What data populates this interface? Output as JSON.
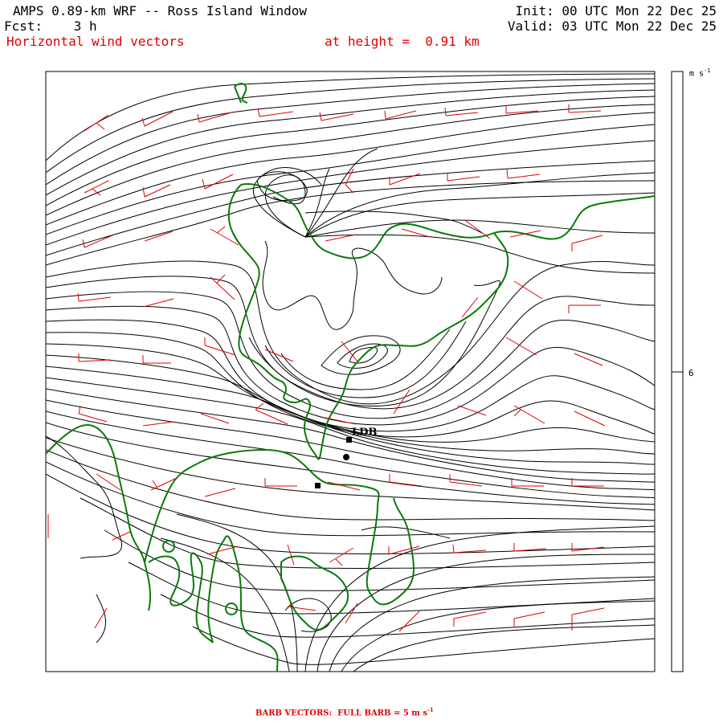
{
  "header": {
    "title": "AMPS 0.89-km WRF -- Ross Island Window",
    "init": "Init: 00 UTC Mon 22 Dec 25",
    "fcst": "Fcst:    3 h",
    "valid": "Valid: 03 UTC Mon 22 Dec 25",
    "field": "Horizontal wind vectors",
    "height": "at height =  0.91 km"
  },
  "scale": {
    "unit": "m s",
    "unit_exp": "-1",
    "tick_value": "6"
  },
  "station": {
    "label": "LDB"
  },
  "legend": {
    "text": "BARB VECTORS:  FULL BARB = 5 m s",
    "exp": "-1"
  },
  "colors": {
    "streamline": "#000000",
    "coastline": "#0a7a0a",
    "barb": "#e00000",
    "text": "#000000",
    "accent_text": "#e00000"
  }
}
